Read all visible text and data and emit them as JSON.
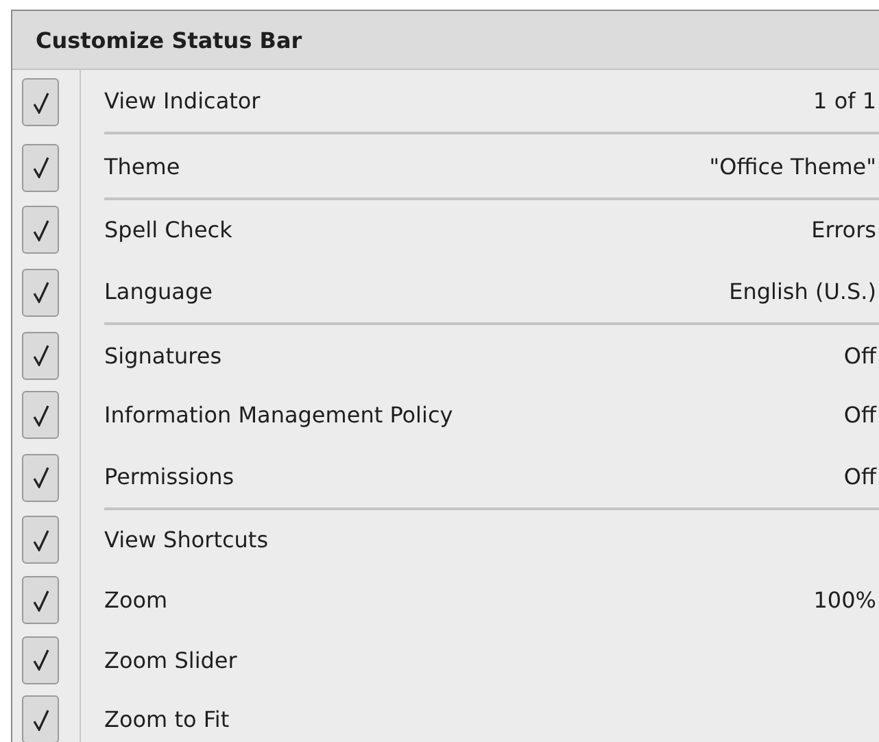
{
  "menu": {
    "title": "Customize Status Bar",
    "items": [
      {
        "label": "View Indicator",
        "value": "1 of 1",
        "checked": true,
        "separator_after": true
      },
      {
        "label": "Theme",
        "value": "\"Office Theme\"",
        "checked": true,
        "separator_after": true
      },
      {
        "label": "Spell Check",
        "value": "Errors",
        "checked": true,
        "separator_after": false
      },
      {
        "label": "Language",
        "value": "English (U.S.)",
        "checked": true,
        "separator_after": true
      },
      {
        "label": "Signatures",
        "value": "Off",
        "checked": true,
        "separator_after": false
      },
      {
        "label": "Information Management Policy",
        "value": "Off",
        "checked": true,
        "separator_after": false
      },
      {
        "label": "Permissions",
        "value": "Off",
        "checked": true,
        "separator_after": true
      },
      {
        "label": "View Shortcuts",
        "checked": true,
        "separator_after": false
      },
      {
        "label": "Zoom",
        "value": "100%",
        "checked": true,
        "separator_after": false
      },
      {
        "label": "Zoom Slider",
        "checked": true,
        "separator_after": false
      },
      {
        "label": "Zoom to Fit",
        "checked": true,
        "separator_after": false
      }
    ]
  }
}
